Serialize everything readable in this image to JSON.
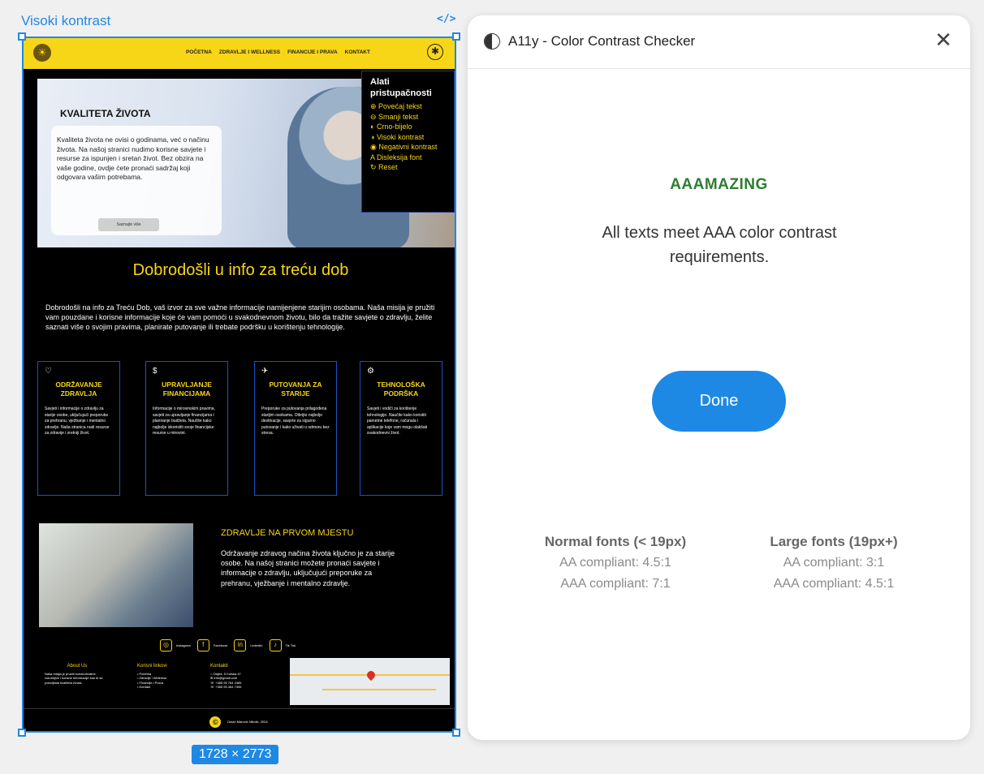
{
  "canvas": {
    "frame_label": "Visoki kontrast",
    "code_icon": "</>",
    "size_badge": "1728 × 2773"
  },
  "site": {
    "nav": {
      "logo_icon": "bee-logo-icon",
      "links": [
        "POČETNA",
        "ZDRAVLJE I WELLNESS",
        "FINANCIJE I PRAVA",
        "KONTAKT"
      ],
      "accessibility_icon": "accessibility-icon"
    },
    "hero": {
      "title": "KVALITETA ŽIVOTA",
      "text": "Kvaliteta života ne ovisi o godinama, već o načinu života. Na našoj stranici nudimo korisne savjete i resurse za ispunjen i sretan život. Bez obzira na vaše godine, ovdje ćete pronaći sadržaj koji odgovara vašim potrebama.",
      "button": "Saznajte više"
    },
    "accessibility_tools": {
      "title": "Alati pristupačnosti",
      "items": [
        "Povećaj tekst",
        "Smanji tekst",
        "Crno-bijelo",
        "Visoki kontrast",
        "Negativni kontrast",
        "Disleksija font",
        "Reset"
      ]
    },
    "welcome_heading": "Dobrodošli u info za treću dob",
    "intro": "Dobrodošli na info za Treću Dob, vaš izvor za sve važne informacije namijenjene starijim osobama. Naša misija je pružiti vam pouzdane i korisne informacije koje će vam pomoći u svakodnevnom životu, bilo da tražite savjete o zdravlju, želite saznati više o svojim pravima, planirate putovanje ili trebate podršku u korištenju tehnologije.",
    "boxes": [
      {
        "icon": "heart-pulse-icon",
        "title": "ODRŽAVANJE ZDRAVLJA",
        "text": "Savjeti i informacije o zdravlju za starije osobe, uključujući preporuke za prehranu, vježbanje i mentalno zdravlje. Naša stranica nudi resurse za zdravije i sretniji život."
      },
      {
        "icon": "money-icon",
        "title": "UPRAVLJANJE FINANCIJAMA",
        "text": "Informacije o mirovinskim pravima, savjeti za upravljanje financijama i planiranje budžeta. Naučite kako najbolje iskoristiti svoje financijske resurse u mirovini."
      },
      {
        "icon": "travel-icon",
        "title": "PUTOVANJA ZA STARIJE",
        "text": "Preporuke za putovanja prilagođena starijim osobama. Otkrijte najbolje destinacije, savjete za sigurno putovanje i kako uživati u odmoru bez stresa."
      },
      {
        "icon": "tech-icon",
        "title": "TEHNOLOŠKA PODRŠKA",
        "text": "Savjeti i vodiči za korištenje tehnologije. Naučite kako koristiti pametne telefone, računala i aplikacije koje vam mogu olakšati svakodnevni život."
      }
    ],
    "health": {
      "heading": "ZDRAVLJE NA PRVOM MJESTU",
      "text": "Održavanje zdravog načina života ključno je za starije osobe. Na našoj stranici možete pronaći savjete i informacije o zdravlju, uključujući preporuke za prehranu, vježbanje i mentalno zdravlje."
    },
    "socials": [
      {
        "icon": "instagram-icon",
        "label": "Instagram"
      },
      {
        "icon": "facebook-icon",
        "label": "Facebook"
      },
      {
        "icon": "linkedin-icon",
        "label": "LinkedIn"
      },
      {
        "icon": "tiktok-icon",
        "label": "Tik Tok"
      }
    ],
    "footer": {
      "about_title": "About Us",
      "about_text": "Naša misija je pružiti sveobuhvatne, razumljive i korisne informacije kao bi se poboljšala kvaliteta života.",
      "links_title": "Korisni linkovi",
      "links": [
        "Početna",
        "Zdravlje i Wellness",
        "Financije i Prava",
        "Kontakt"
      ],
      "contact_title": "Kontakti",
      "contacts": [
        "Osijek, 5 Kolska 47",
        "info@gmail.com",
        "+385 95 784 2485",
        "+385 95 484 7496"
      ],
      "copyright": "David Marović Nikolić, 2024."
    }
  },
  "panel": {
    "title": "A11y - Color Contrast Checker",
    "result_title": "AAAMAZING",
    "result_text": "All texts meet AAA color contrast requirements.",
    "done": "Done",
    "normal": {
      "heading": "Normal fonts (< 19px)",
      "aa": "AA compliant: 4.5:1",
      "aaa": "AAA compliant: 7:1"
    },
    "large": {
      "heading": "Large fonts (19px+)",
      "aa": "AA compliant: 3:1",
      "aaa": "AAA compliant: 4.5:1"
    },
    "success_color": "#2e7d32",
    "accent_color": "#1e88e5"
  }
}
